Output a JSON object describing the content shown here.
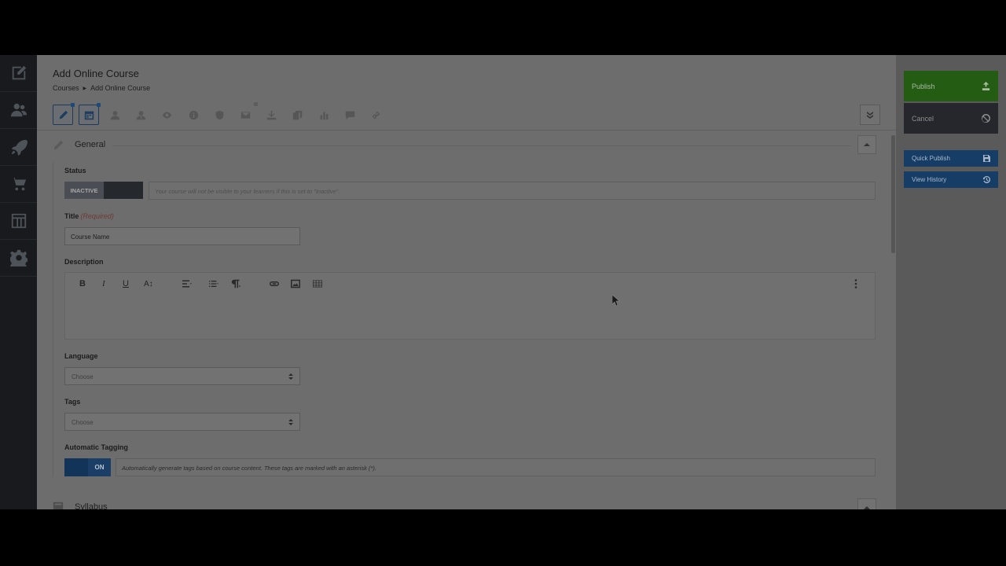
{
  "page": {
    "title": "Add Online Course",
    "breadcrumb": [
      "Courses",
      "Add Online Course"
    ]
  },
  "leftnav": {
    "items": [
      {
        "icon": "edit-square-icon"
      },
      {
        "icon": "users-icon"
      },
      {
        "icon": "rocket-icon"
      },
      {
        "icon": "cart-icon"
      },
      {
        "icon": "layout-icon"
      },
      {
        "icon": "gear-icon"
      }
    ]
  },
  "toolbar": {
    "icons": [
      "pencil-icon",
      "calendar-icon",
      "user-icon",
      "user-tie-icon",
      "eye-icon",
      "info-icon",
      "shield-icon",
      "email-icon",
      "download-icon",
      "copy-icon",
      "bar-chart-icon",
      "comment-icon",
      "link-icon"
    ],
    "active": [
      "pencil-icon",
      "calendar-icon"
    ],
    "collapse_icon": "double-chevron-down-icon"
  },
  "general": {
    "title": "General",
    "status": {
      "label": "Status",
      "value": "INACTIVE",
      "help": "Your course will not be visible to your learners if this is set to \"Inactive\"."
    },
    "title_field": {
      "label": "Title",
      "required": "(Required)",
      "value": "Course Name"
    },
    "description": {
      "label": "Description",
      "toolbar": [
        "B",
        "I",
        "U",
        "A↕"
      ]
    },
    "language": {
      "label": "Language",
      "placeholder": "Choose"
    },
    "tags": {
      "label": "Tags",
      "placeholder": "Choose"
    },
    "auto_tagging": {
      "label": "Automatic Tagging",
      "value": "ON",
      "help": "Automatically generate tags based on course content. These tags are marked with an asterisk (*)."
    }
  },
  "syllabus": {
    "title": "Syllabus"
  },
  "actions": {
    "publish": "Publish",
    "cancel": "Cancel",
    "quick_publish": "Quick Publish",
    "view_history": "View History"
  }
}
